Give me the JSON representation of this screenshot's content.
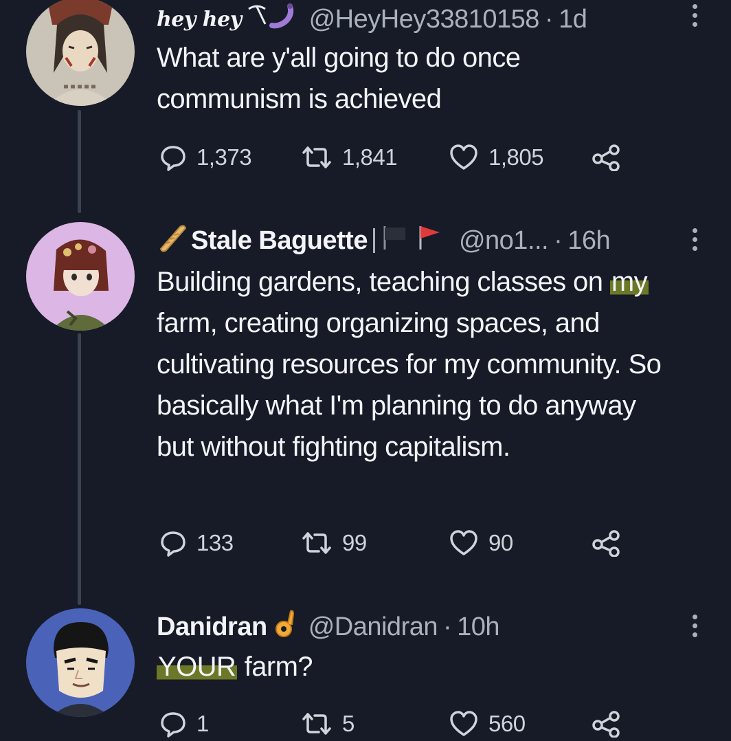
{
  "tweets": [
    {
      "display_name": "hey hey",
      "handle": "@HeyHey33810158",
      "time": "1d",
      "text": "What are y'all going to do once communism is achieved",
      "replies": "1,373",
      "retweets": "1,841",
      "likes": "1,805"
    },
    {
      "display_name": "Stale Baguette",
      "handle": "@no1...",
      "time": "16h",
      "text_before": "Building gardens, teaching classes on ",
      "highlight": "my",
      "text_after": " farm,  creating organizing spaces, and cultivating resources for my community. So basically what I'm planning to do anyway but without fighting capitalism.",
      "replies": "133",
      "retweets": "99",
      "likes": "90"
    },
    {
      "display_name": "Danidran",
      "handle": "@Danidran",
      "time": "10h",
      "highlight": "YOUR",
      "text_after": " farm?",
      "replies": "1",
      "retweets": "5",
      "likes": "560"
    }
  ],
  "separator": "·",
  "colors": {
    "background": "#161b27",
    "text": "#f2f4f7",
    "secondary": "#aab1bd",
    "highlight": "#b2c428",
    "thread_line": "#3a4150"
  },
  "icons": [
    "reply-icon",
    "retweet-icon",
    "like-icon",
    "share-icon",
    "more-icon",
    "baguette-icon",
    "flag-icon",
    "ok-hand-icon",
    "pickaxe-icon",
    "worm-icon"
  ]
}
